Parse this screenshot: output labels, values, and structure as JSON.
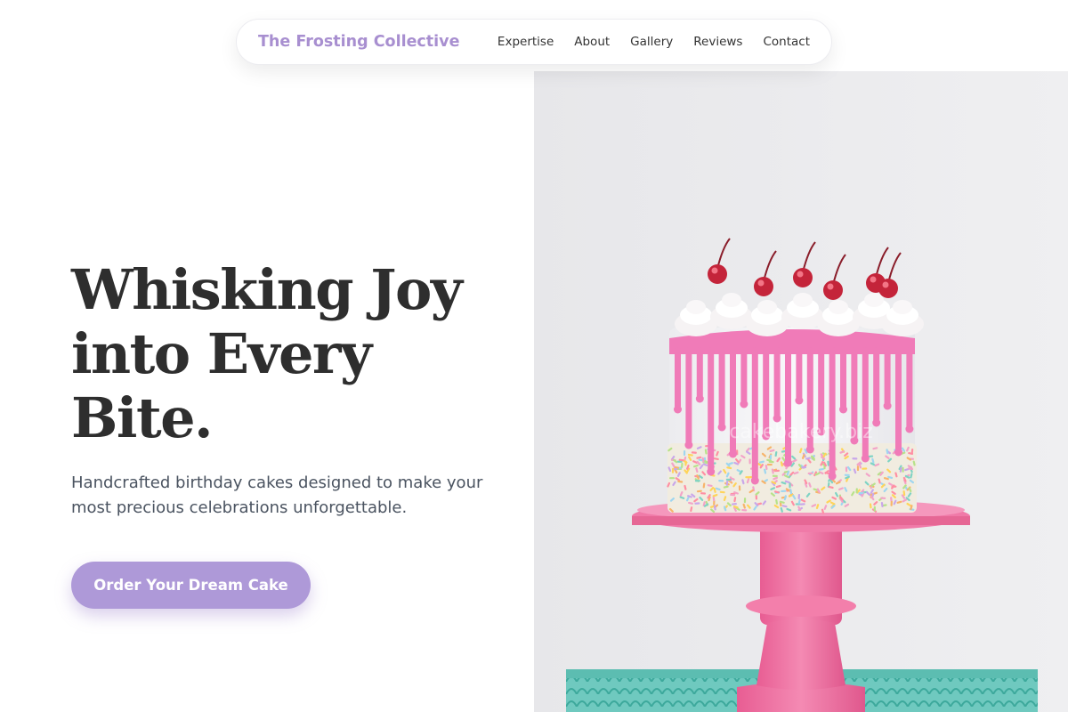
{
  "nav": {
    "brand": "The Frosting Collective",
    "links": [
      "Expertise",
      "About",
      "Gallery",
      "Reviews",
      "Contact"
    ]
  },
  "hero": {
    "title_lines": [
      "Whisking Joy",
      "into Every",
      "Bite."
    ],
    "subtitle": "Handcrafted birthday cakes designed to make your most precious celebrations unforgettable.",
    "cta_label": "Order Your Dream Cake"
  },
  "image": {
    "subject": "pink drip birthday cake with cherries and sprinkles on a pink cake stand",
    "watermark": "cakebakery.biz"
  },
  "colors": {
    "brand": "#a88fd0",
    "cta": "#ae99d8",
    "heading": "#2e2e2e",
    "body_text": "#4a5360",
    "photo_bg": "#ececee",
    "drip_pink": "#f07bb8",
    "stand_pink": "#ec6fa0"
  }
}
